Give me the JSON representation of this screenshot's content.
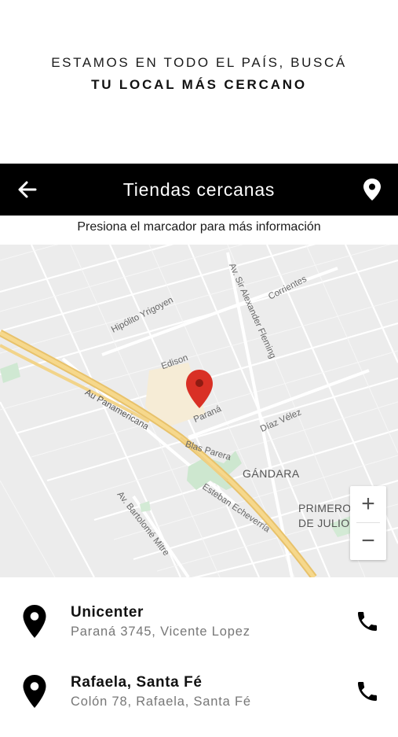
{
  "headline": {
    "line1": "ESTAMOS EN TODO EL PAÍS, BUSCÁ",
    "line2": "TU LOCAL MÁS CERCANO"
  },
  "topbar": {
    "title": "Tiendas cercanas",
    "back_icon": "arrow-left-icon",
    "location_icon": "location-pin-icon"
  },
  "hint": "Presiona el marcador para más información",
  "map": {
    "streets": {
      "hipolito": "Hipólito Yrigoyen",
      "corrientes": "Corrientes",
      "fleming": "Av. Sir Alexander Fleming",
      "edison": "Edison",
      "parana": "Paraná",
      "panamericana": "Au Panamericana",
      "diaz_velez": "Díaz Vélez",
      "blas_parera": "Blas Parera",
      "gandara": "GÁNDARA",
      "echeverria": "Esteban Echeverría",
      "bartolome": "Av. Bartolomé Mitre",
      "primero_1": "PRIMERO",
      "primero_2": "DE JULIO"
    },
    "marker_color": "#d93025",
    "zoom_in": "+",
    "zoom_out": "−"
  },
  "stores": [
    {
      "name": "Unicenter",
      "address": "Paraná 3745, Vicente Lopez"
    },
    {
      "name": "Rafaela, Santa Fé",
      "address": "Colón 78, Rafaela, Santa Fé"
    }
  ]
}
